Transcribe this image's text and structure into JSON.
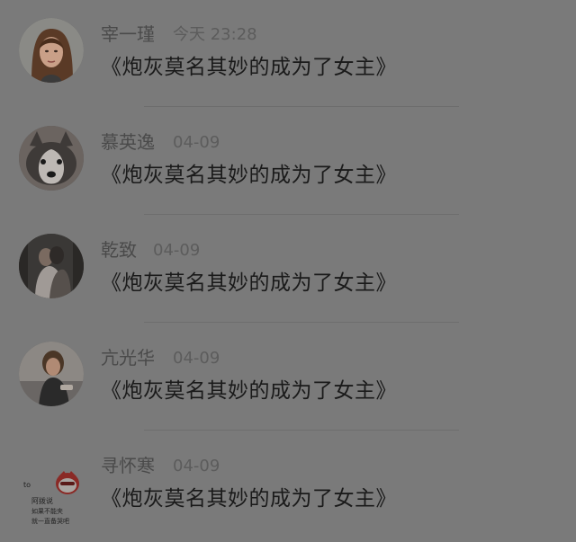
{
  "comments": [
    {
      "name": "宰一瑾",
      "time": "今天 23:28",
      "text": "《炮灰莫名其妙的成为了女主》",
      "avatar_icon": "woman-portrait-avatar"
    },
    {
      "name": "慕英逸",
      "time": "04-09",
      "text": "《炮灰莫名其妙的成为了女主》",
      "avatar_icon": "husky-dog-avatar"
    },
    {
      "name": "乾致",
      "time": "04-09",
      "text": "《炮灰莫名其妙的成为了女主》",
      "avatar_icon": "couple-photo-avatar"
    },
    {
      "name": "亢光华",
      "time": "04-09",
      "text": "《炮灰莫名其妙的成为了女主》",
      "avatar_icon": "girl-photo-avatar"
    },
    {
      "name": "寻怀寒",
      "time": "04-09",
      "text": "《炮灰莫名其妙的成为了女主》",
      "avatar_icon": "cartoon-sticker-avatar",
      "avatar_text": [
        "to",
        "阿拨说",
        "如果不能夹",
        "就一直备哭吧"
      ]
    }
  ]
}
